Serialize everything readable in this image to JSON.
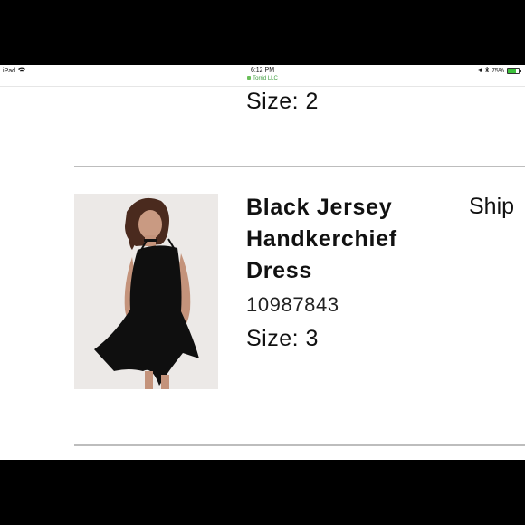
{
  "status_bar": {
    "device": "iPad",
    "time": "6:12 PM",
    "battery": "75%",
    "battery_level": 0.75
  },
  "url_bar": {
    "site": "Torrid LLC"
  },
  "previous_item": {
    "size": "Size: 2"
  },
  "item": {
    "name": "Black Jersey Handkerchief Dress",
    "sku": "10987843",
    "size": "Size: 3",
    "shipping": "Ship"
  },
  "colors": {
    "accent_green": "#3a9a3a",
    "battery_green": "#3cc13b",
    "divider": "#bdbdbd"
  }
}
